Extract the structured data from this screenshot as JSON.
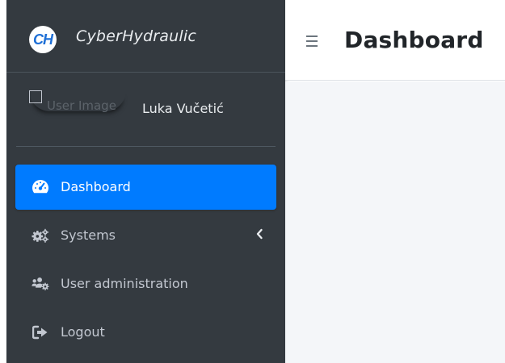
{
  "brand": {
    "logo_text": "CH",
    "name": "CyberHydraulic"
  },
  "user": {
    "image_alt": "User Image",
    "name": "Luka Vučetić"
  },
  "nav": {
    "items": [
      {
        "label": "Dashboard",
        "icon": "tachometer-icon",
        "active": true
      },
      {
        "label": "Systems",
        "icon": "cogs-icon",
        "active": false,
        "has_submenu": true
      },
      {
        "label": "User administration",
        "icon": "users-cog-icon",
        "active": false
      },
      {
        "label": "Logout",
        "icon": "sign-out-icon",
        "active": false
      }
    ]
  },
  "header": {
    "title": "Dashboard"
  },
  "colors": {
    "sidebar_bg": "#343a40",
    "active_bg": "#007bff",
    "content_bg": "#f4f6f9",
    "nav_text": "#c2c7d0"
  }
}
